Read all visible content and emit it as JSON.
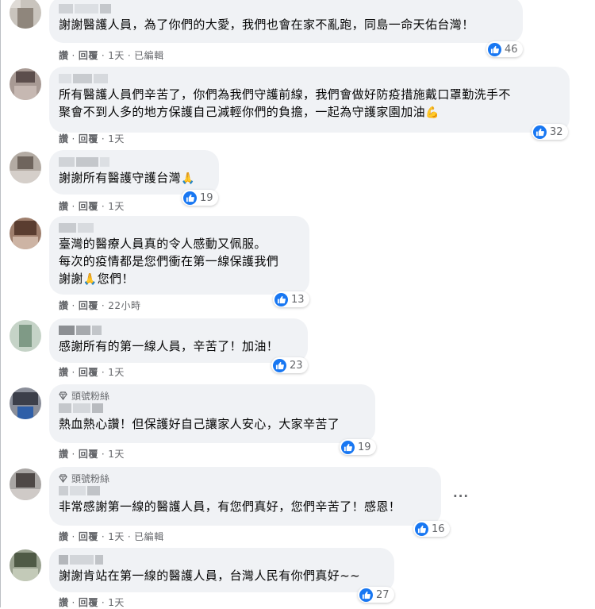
{
  "actions": {
    "like": "讚",
    "reply": "回覆",
    "separator": "·",
    "edited": "已編輯"
  },
  "more_label": "···",
  "comments": [
    {
      "text": "謝謝醫護人員，為了你們的大愛，我們也會在家不亂跑，同島一命天佑台灣！",
      "likes": "46",
      "time": "1天"
    },
    {
      "text": "所有醫護人員們辛苦了，你們為我們守護前線，我們會做好防疫措施戴口罩勤洗手不\n聚會不到人多的地方保護自己減輕你們的負擔，一起為守護家園加油",
      "emoji": "💪",
      "likes": "32",
      "time": "1天"
    },
    {
      "text": "謝謝所有醫護守護台灣",
      "emoji": "🙏",
      "likes": "19",
      "time": "1天"
    },
    {
      "text_line1": "臺灣的醫療人員真的令人感動又佩服。",
      "text_line2": "每次的疫情都是您們衝在第一線保護我們",
      "text_line3a": "謝謝",
      "emoji": "🙏",
      "text_line3b": "您們！",
      "likes": "13",
      "time": "22小時"
    },
    {
      "text": "感謝所有的第一線人員，辛苦了！加油！",
      "likes": "23",
      "time": "1天"
    },
    {
      "badge": "頭號粉絲",
      "text": "熱血熱心讚！但保護好自己讓家人安心，大家辛苦了",
      "likes": "19",
      "time": "1天"
    },
    {
      "badge": "頭號粉絲",
      "text": "非常感謝第一線的醫護人員，有您們真好，您們辛苦了！感恩！",
      "likes": "16",
      "time": "1天"
    },
    {
      "text": "謝謝肯站在第一線的醫護人員，台灣人民有你們真好~~",
      "likes": "27",
      "time": "1天"
    }
  ],
  "colors": {
    "like_blue": "#1877f2",
    "bubble_bg": "#f0f2f5",
    "meta_gray": "#65676b"
  },
  "icons": {
    "like": "thumbs-up-icon",
    "badge": "diamond-icon",
    "more": "more-options-icon"
  }
}
